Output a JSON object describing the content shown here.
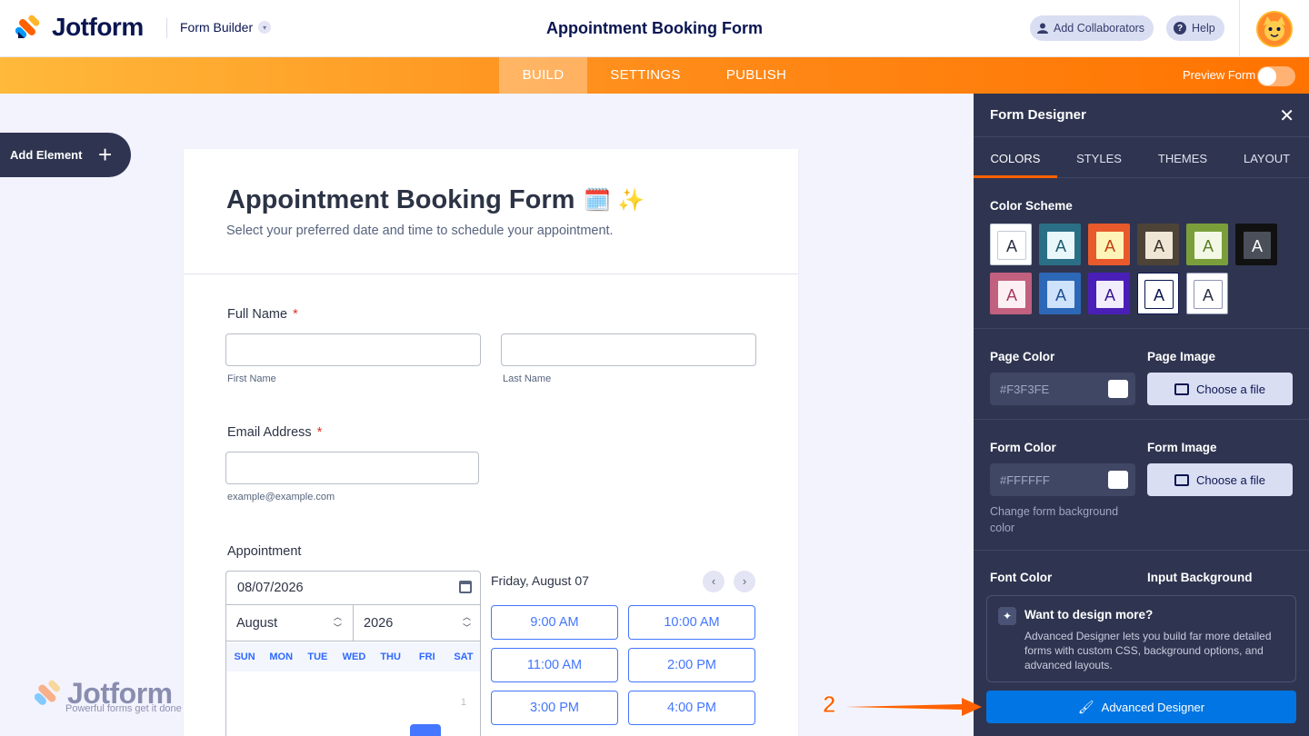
{
  "app": {
    "logo_text": "Jotform",
    "mode_label": "Form Builder",
    "title": "Appointment Booking Form",
    "add_collaborators": "Add Collaborators",
    "help": "Help"
  },
  "nav": {
    "tabs": [
      "BUILD",
      "SETTINGS",
      "PUBLISH"
    ],
    "active": "BUILD",
    "preview_label": "Preview Form",
    "preview_on": false
  },
  "sidebar": {
    "add_element": "Add Element"
  },
  "form": {
    "title": "Appointment Booking Form",
    "title_emoji": "🗓️ ✨",
    "subtitle": "Select your preferred date and time to schedule your appointment.",
    "full_name": {
      "label": "Full Name",
      "required_mark": "*",
      "first_value": "",
      "last_value": "",
      "first_sublabel": "First Name",
      "last_sublabel": "Last Name"
    },
    "email": {
      "label": "Email Address",
      "required_mark": "*",
      "value": "",
      "sublabel": "example@example.com"
    },
    "appointment": {
      "label": "Appointment",
      "date_value": "08/07/2026",
      "month": "August",
      "year": "2026",
      "weekdays": [
        "SUN",
        "MON",
        "TUE",
        "WED",
        "THU",
        "FRI",
        "SAT"
      ],
      "first_day": "1",
      "selected_day_heading": "Friday, August 07",
      "slots": [
        "9:00 AM",
        "10:00 AM",
        "11:00 AM",
        "2:00 PM",
        "3:00 PM",
        "4:00 PM"
      ]
    }
  },
  "watermark": {
    "text": "Jotform",
    "tagline": "Powerful forms get it done"
  },
  "designer": {
    "title": "Form Designer",
    "tabs": [
      "COLORS",
      "STYLES",
      "THEMES",
      "LAYOUT"
    ],
    "active_tab": "COLORS",
    "color_scheme_label": "Color Scheme",
    "swatch_letter": "A",
    "swatches": [
      {
        "outer": "#ffffff",
        "inner": "#ffffff",
        "text": "#2c3345",
        "border": "#c3cad8"
      },
      {
        "outer": "#2b6f86",
        "inner": "#e9f7fb",
        "text": "#1e5a6f",
        "border": "#2b6f86"
      },
      {
        "outer": "#e85a2c",
        "inner": "#fff4b8",
        "text": "#c2400f",
        "border": "#e85a2c"
      },
      {
        "outer": "#4d4337",
        "inner": "#efe6d6",
        "text": "#3c3329",
        "border": "#4d4337"
      },
      {
        "outer": "#7a9f3a",
        "inner": "#f3f8e6",
        "text": "#5d7d26",
        "border": "#7a9f3a"
      },
      {
        "outer": "#111111",
        "inner": "#4a4f5a",
        "text": "#ffffff",
        "border": "#111111"
      },
      {
        "outer": "#c2607f",
        "inner": "#fdf0f4",
        "text": "#a33c5e",
        "border": "#c2607f"
      },
      {
        "outer": "#2d67b7",
        "inner": "#cfe2fb",
        "text": "#1d4f94",
        "border": "#2d67b7"
      },
      {
        "outer": "#4a1fb8",
        "inner": "#f1edfc",
        "text": "#3a1694",
        "border": "#4a1fb8"
      },
      {
        "outer": "#ffffff",
        "inner": "#ffffff",
        "text": "#0a1551",
        "border": "#0a1551"
      },
      {
        "outer": "#ffffff",
        "inner": "#ffffff",
        "text": "#2c3345",
        "border": "#8f96b3"
      }
    ],
    "page_color_label": "Page Color",
    "page_color_value": "#F3F3FE",
    "page_image_label": "Page Image",
    "choose_file": "Choose a file",
    "form_color_label": "Form Color",
    "form_color_value": "#FFFFFF",
    "form_image_label": "Form Image",
    "form_color_hint": "Change form background color",
    "font_color_label": "Font Color",
    "input_background_label": "Input Background",
    "promo_title": "Want to design more?",
    "promo_text": "Advanced Designer lets you build far more detailed forms with custom CSS, background options, and advanced layouts.",
    "advanced_button": "Advanced Designer"
  },
  "annotation": {
    "step_number": "2"
  },
  "colors": {
    "accent_orange": "#ff6100",
    "primary_blue": "#4476ff",
    "panel_bg": "#2f3550"
  }
}
